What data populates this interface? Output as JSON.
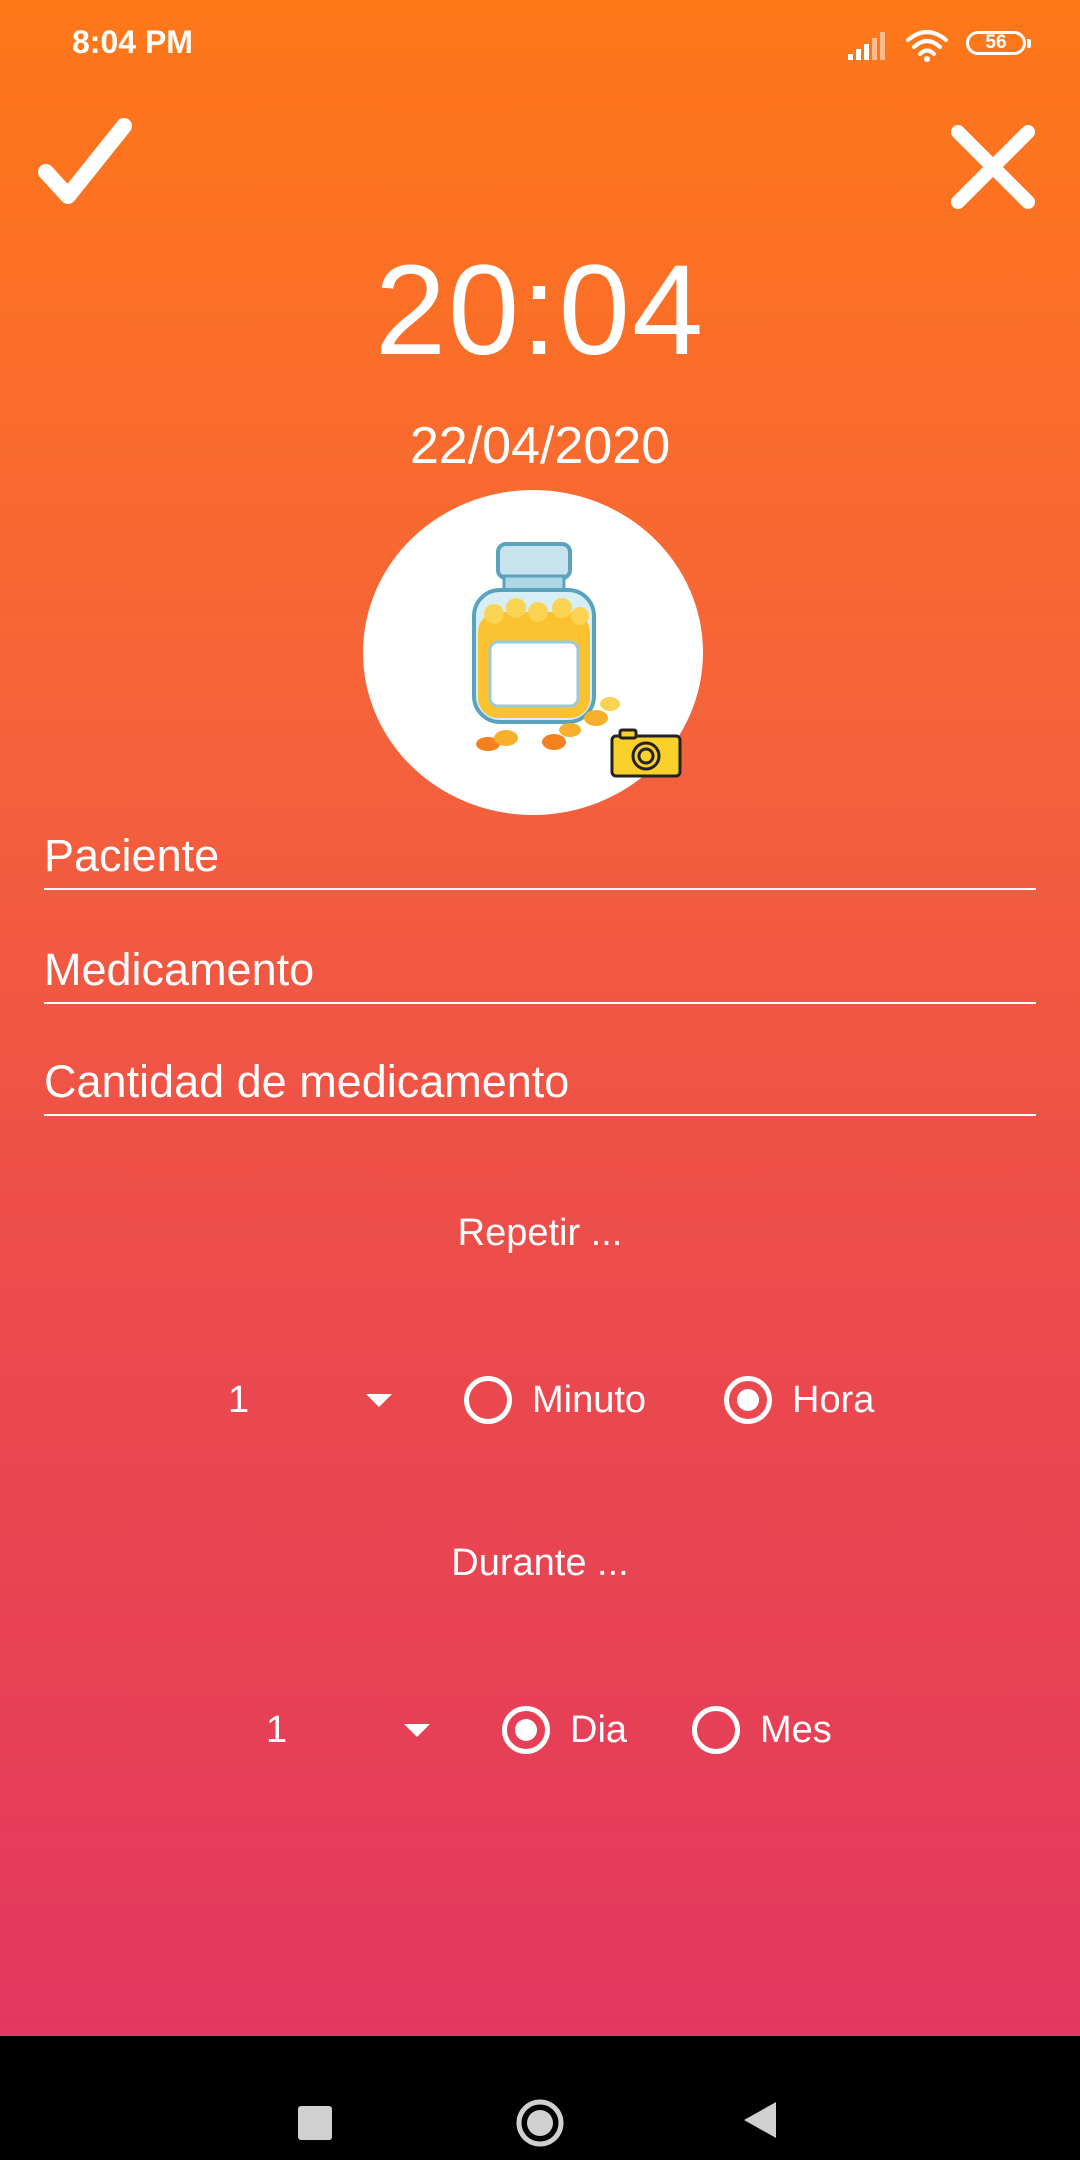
{
  "status_bar": {
    "time": "8:04 PM",
    "battery": "56"
  },
  "header": {
    "confirm_icon": "check-icon",
    "close_icon": "close-icon"
  },
  "clock": {
    "time": "20:04",
    "date": "22/04/2020"
  },
  "avatar": {
    "image": "pill-bottle-illustration",
    "camera_icon": "camera-icon"
  },
  "fields": {
    "paciente": "Paciente",
    "medicamento": "Medicamento",
    "cantidad": "Cantidad de medicamento"
  },
  "repetir": {
    "label": "Repetir ...",
    "value": "1",
    "options": [
      {
        "label": "Minuto",
        "checked": false
      },
      {
        "label": "Hora",
        "checked": true
      }
    ]
  },
  "durante": {
    "label": "Durante ...",
    "value": "1",
    "options": [
      {
        "label": "Dia",
        "checked": true
      },
      {
        "label": "Mes",
        "checked": false
      }
    ]
  },
  "colors": {
    "gradient_top": "#ff7818",
    "gradient_bottom": "#e3385f",
    "navbar": "#000000"
  }
}
